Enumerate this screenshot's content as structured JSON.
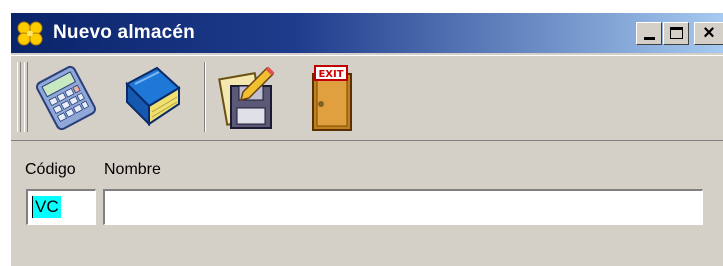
{
  "window": {
    "title": "Nuevo almacén",
    "controls": {
      "minimize": "minimize",
      "maximize": "maximize",
      "close": "×"
    }
  },
  "toolbar": {
    "items": [
      {
        "name": "calculator",
        "icon": "calculator-icon"
      },
      {
        "name": "book",
        "icon": "book-icon"
      },
      {
        "name": "edit-document",
        "icon": "edit-document-icon"
      },
      {
        "name": "exit",
        "icon": "exit-door-icon",
        "sign_text": "EXIT"
      }
    ]
  },
  "form": {
    "codigo_label": "Código",
    "nombre_label": "Nombre",
    "codigo_value": "VC",
    "nombre_value": ""
  },
  "colors": {
    "titlebar_start": "#0a246a",
    "titlebar_end": "#a6caf0",
    "face": "#d4d0c8",
    "selection": "#00ffff"
  }
}
